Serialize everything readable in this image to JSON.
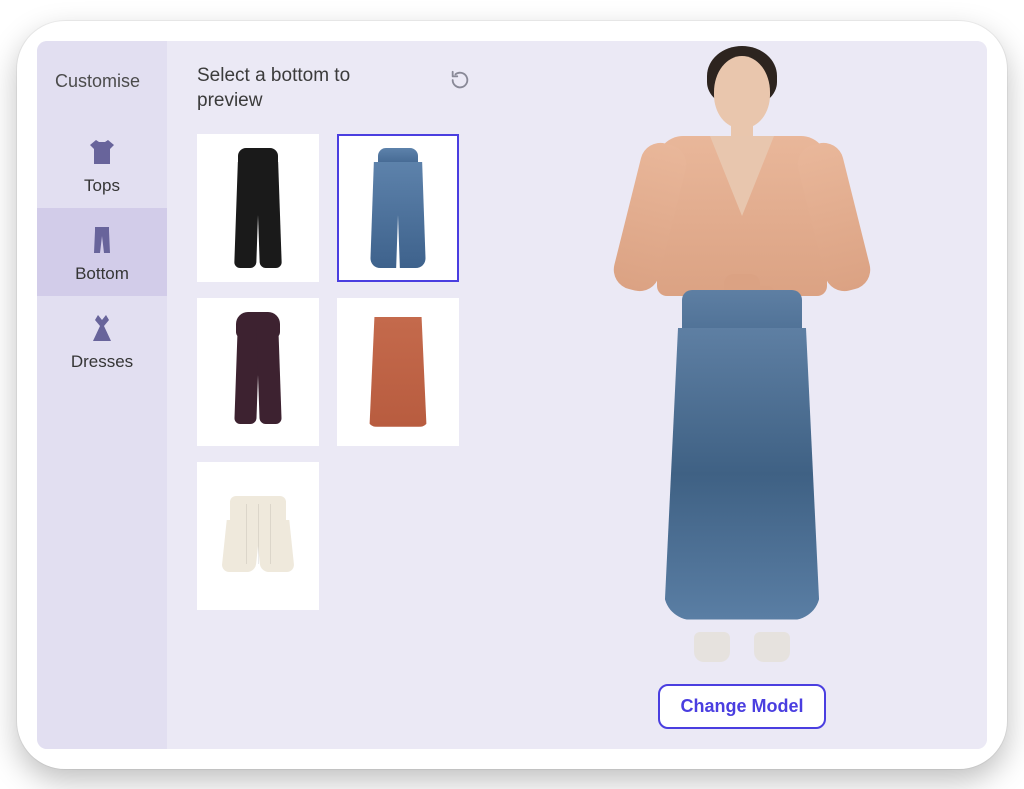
{
  "colors": {
    "accent": "#4a3ee0",
    "panel_bg": "#ebe9f5",
    "sidebar_bg": "#e2dff1",
    "sidebar_active_bg": "#d2cce9"
  },
  "sidebar": {
    "title": "Customise",
    "categories": [
      {
        "id": "tops",
        "label": "Tops",
        "icon": "tops-icon",
        "active": false
      },
      {
        "id": "bottom",
        "label": "Bottom",
        "icon": "bottom-icon",
        "active": true
      },
      {
        "id": "dresses",
        "label": "Dresses",
        "icon": "dresses-icon",
        "active": false
      }
    ]
  },
  "selection": {
    "title": "Select a bottom to preview",
    "reset_icon": "reset-icon",
    "items": [
      {
        "id": "black-trousers",
        "name": "Black trousers",
        "selected": false
      },
      {
        "id": "blue-jeans",
        "name": "Blue wide-leg jeans",
        "selected": true
      },
      {
        "id": "plum-trousers",
        "name": "Plum high-waist trousers",
        "selected": false
      },
      {
        "id": "rust-skirt",
        "name": "Rust pencil skirt",
        "selected": false
      },
      {
        "id": "beige-shorts",
        "name": "Beige pleated shorts",
        "selected": false
      }
    ]
  },
  "preview": {
    "change_model_label": "Change Model",
    "model_outfit": {
      "top": "Peach wrap blouse",
      "bottom": "Blue wide-leg jeans",
      "shoes": "Clear block heels"
    }
  }
}
